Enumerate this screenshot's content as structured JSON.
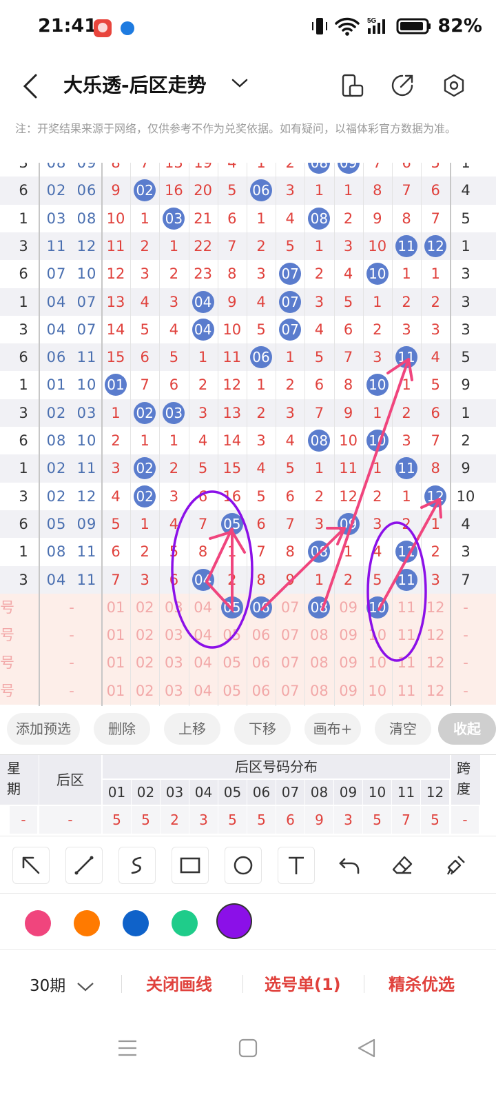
{
  "status_bar": {
    "time": "21:41",
    "battery": "82%",
    "network": "5G"
  },
  "header": {
    "title": "大乐透-后区走势"
  },
  "notice": "注：开奖结果来源于网络，仅供参考不作为兑奖依据。如有疑问，以福体彩官方数据为准。",
  "table": {
    "rows": [
      {
        "wk": "3",
        "bq": "08  09",
        "cells": [
          "8",
          "7",
          "13",
          "19",
          "4",
          "1",
          "2",
          "08",
          "09",
          "7",
          "6",
          "5"
        ],
        "sp": "1"
      },
      {
        "wk": "6",
        "bq": "02  06",
        "cells": [
          "9",
          "02",
          "16",
          "20",
          "5",
          "06",
          "3",
          "1",
          "1",
          "8",
          "7",
          "6"
        ],
        "sp": "4"
      },
      {
        "wk": "1",
        "bq": "03  08",
        "cells": [
          "10",
          "1",
          "03",
          "21",
          "6",
          "1",
          "4",
          "08",
          "2",
          "9",
          "8",
          "7"
        ],
        "sp": "5"
      },
      {
        "wk": "3",
        "bq": "11  12",
        "cells": [
          "11",
          "2",
          "1",
          "22",
          "7",
          "2",
          "5",
          "1",
          "3",
          "10",
          "11",
          "12"
        ],
        "sp": "1"
      },
      {
        "wk": "6",
        "bq": "07  10",
        "cells": [
          "12",
          "3",
          "2",
          "23",
          "8",
          "3",
          "07",
          "2",
          "4",
          "10",
          "1",
          "1"
        ],
        "sp": "3"
      },
      {
        "wk": "1",
        "bq": "04  07",
        "cells": [
          "13",
          "4",
          "3",
          "04",
          "9",
          "4",
          "07",
          "3",
          "5",
          "1",
          "2",
          "2"
        ],
        "sp": "3"
      },
      {
        "wk": "3",
        "bq": "04  07",
        "cells": [
          "14",
          "5",
          "4",
          "04",
          "10",
          "5",
          "07",
          "4",
          "6",
          "2",
          "3",
          "3"
        ],
        "sp": "3"
      },
      {
        "wk": "6",
        "bq": "06  11",
        "cells": [
          "15",
          "6",
          "5",
          "1",
          "11",
          "06",
          "1",
          "5",
          "7",
          "3",
          "11",
          "4"
        ],
        "sp": "5"
      },
      {
        "wk": "1",
        "bq": "01  10",
        "cells": [
          "01",
          "7",
          "6",
          "2",
          "12",
          "1",
          "2",
          "6",
          "8",
          "10",
          "1",
          "5"
        ],
        "sp": "9"
      },
      {
        "wk": "3",
        "bq": "02  03",
        "cells": [
          "1",
          "02",
          "03",
          "3",
          "13",
          "2",
          "3",
          "7",
          "9",
          "1",
          "2",
          "6"
        ],
        "sp": "1"
      },
      {
        "wk": "6",
        "bq": "08  10",
        "cells": [
          "2",
          "1",
          "1",
          "4",
          "14",
          "3",
          "4",
          "08",
          "10",
          "10",
          "3",
          "7"
        ],
        "sp": "2"
      },
      {
        "wk": "1",
        "bq": "02  11",
        "cells": [
          "3",
          "02",
          "2",
          "5",
          "15",
          "4",
          "5",
          "1",
          "11",
          "1",
          "11",
          "8"
        ],
        "sp": "9"
      },
      {
        "wk": "3",
        "bq": "02  12",
        "cells": [
          "4",
          "02",
          "3",
          "6",
          "16",
          "5",
          "6",
          "2",
          "12",
          "2",
          "1",
          "12"
        ],
        "sp": "10"
      },
      {
        "wk": "6",
        "bq": "05  09",
        "cells": [
          "5",
          "1",
          "4",
          "7",
          "05",
          "6",
          "7",
          "3",
          "09",
          "3",
          "2",
          "1"
        ],
        "sp": "4"
      },
      {
        "wk": "1",
        "bq": "08  11",
        "cells": [
          "6",
          "2",
          "5",
          "8",
          "1",
          "7",
          "8",
          "08",
          "1",
          "4",
          "11",
          "2"
        ],
        "sp": "3"
      },
      {
        "wk": "3",
        "bq": "04  11",
        "cells": [
          "7",
          "3",
          "6",
          "04",
          "2",
          "8",
          "9",
          "1",
          "2",
          "5",
          "11",
          "3"
        ],
        "sp": "7"
      }
    ],
    "balls": [
      [
        7,
        8
      ],
      [
        1,
        5
      ],
      [
        2,
        7
      ],
      [
        10,
        11
      ],
      [
        6,
        9
      ],
      [
        3,
        6
      ],
      [
        3,
        6
      ],
      [
        5,
        10
      ],
      [
        0,
        9
      ],
      [
        1,
        2
      ],
      [
        7,
        9
      ],
      [
        1,
        10
      ],
      [
        1,
        11
      ],
      [
        4,
        8
      ],
      [
        7,
        10
      ],
      [
        3,
        10
      ]
    ],
    "pick_rows": [
      {
        "label": "号",
        "dash1": "-",
        "nums": [
          "01",
          "02",
          "03",
          "04",
          "05",
          "06",
          "07",
          "08",
          "09",
          "10",
          "11",
          "12"
        ],
        "dash2": "-",
        "selected": [
          4,
          5,
          7,
          9
        ]
      },
      {
        "label": "号",
        "dash1": "-",
        "nums": [
          "01",
          "02",
          "03",
          "04",
          "05",
          "06",
          "07",
          "08",
          "09",
          "10",
          "11",
          "12"
        ],
        "dash2": "-",
        "selected": []
      },
      {
        "label": "号",
        "dash1": "-",
        "nums": [
          "01",
          "02",
          "03",
          "04",
          "05",
          "06",
          "07",
          "08",
          "09",
          "10",
          "11",
          "12"
        ],
        "dash2": "-",
        "selected": []
      },
      {
        "label": "号",
        "dash1": "-",
        "nums": [
          "01",
          "02",
          "03",
          "04",
          "05",
          "06",
          "07",
          "08",
          "09",
          "10",
          "11",
          "12"
        ],
        "dash2": "-",
        "selected": []
      }
    ]
  },
  "actions": [
    "添加预选",
    "删除",
    "上移",
    "下移",
    "画布+",
    "清空",
    "收起"
  ],
  "summary": {
    "h_week": "星期",
    "h_back": "后区",
    "h_dist": "后区号码分布",
    "h_span": "跨度",
    "cols": [
      "01",
      "02",
      "03",
      "04",
      "05",
      "06",
      "07",
      "08",
      "09",
      "10",
      "11",
      "12"
    ],
    "wk_val": "-",
    "back_val": "-",
    "values": [
      "5",
      "5",
      "2",
      "3",
      "5",
      "5",
      "6",
      "9",
      "3",
      "5",
      "7",
      "5"
    ],
    "span_val": "-"
  },
  "tools": [
    "arrow-tool-icon",
    "line-tool-icon",
    "freehand-tool-icon",
    "rectangle-tool-icon",
    "circle-tool-icon",
    "text-tool-icon",
    "undo-icon",
    "eraser-icon",
    "clear-brush-icon"
  ],
  "palette": [
    "#f0457d",
    "#ff7a00",
    "#0f62c9",
    "#1fcc8a",
    "#8b10e8"
  ],
  "bottom": {
    "period": "30期",
    "close_draw": "关闭画线",
    "pick_list": "选号单(1)",
    "premium": "精杀优选"
  }
}
